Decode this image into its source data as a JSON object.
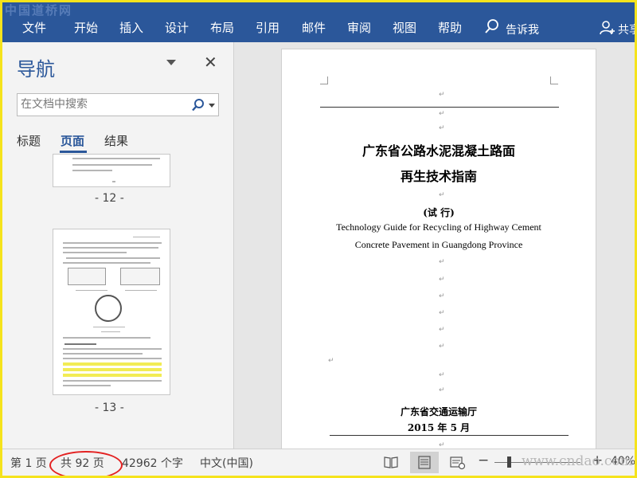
{
  "watermarks": {
    "top": "中国道桥网",
    "bottom": "www.cndao.com"
  },
  "ribbon": {
    "tabs": [
      "文件",
      "开始",
      "插入",
      "设计",
      "布局",
      "引用",
      "邮件",
      "审阅",
      "视图",
      "帮助"
    ],
    "tell_me": "告诉我",
    "share": "共享"
  },
  "nav": {
    "title": "导航",
    "search_placeholder": "在文档中搜索",
    "tabs": [
      "标题",
      "页面",
      "结果"
    ],
    "active_tab": "页面",
    "pages": [
      "- 12 -",
      "- 13 -"
    ]
  },
  "document": {
    "title_line1": "广东省公路水泥混凝土路面",
    "title_line2": "再生技术指南",
    "trial": "(试 行)",
    "en_line1": "Technology Guide for Recycling of Highway Cement",
    "en_line2": "Concrete Pavement in Guangdong Province",
    "issuer": "广东省交通运输厅",
    "date": "2015 年 5 月",
    "paragraph_mark": "↵"
  },
  "status": {
    "page": "第 1 页",
    "page_count": "共 92 页",
    "word_count": "42962 个字",
    "language": "中文(中国)",
    "zoom_minus": "−",
    "zoom_plus": "+",
    "zoom_level": "40%"
  },
  "colors": {
    "ribbon": "#2b579a",
    "annotation": "#e32121",
    "frame": "#f5e31c"
  }
}
